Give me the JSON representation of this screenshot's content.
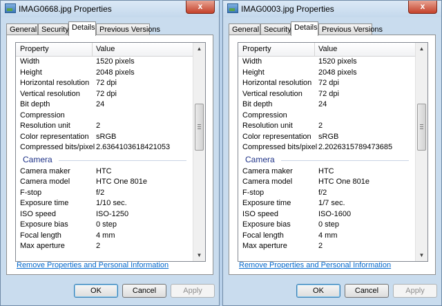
{
  "windows": [
    {
      "title": "IMAG0668.jpg Properties",
      "tabs": [
        {
          "label": "General",
          "active": false
        },
        {
          "label": "Security",
          "active": false
        },
        {
          "label": "Details",
          "active": true
        },
        {
          "label": "Previous Versions",
          "active": false
        }
      ],
      "columns": {
        "property": "Property",
        "value": "Value"
      },
      "rows": [
        {
          "p": "Width",
          "v": "1520 pixels"
        },
        {
          "p": "Height",
          "v": "2048 pixels"
        },
        {
          "p": "Horizontal resolution",
          "v": "72 dpi"
        },
        {
          "p": "Vertical resolution",
          "v": "72 dpi"
        },
        {
          "p": "Bit depth",
          "v": "24"
        },
        {
          "p": "Compression",
          "v": ""
        },
        {
          "p": "Resolution unit",
          "v": "2"
        },
        {
          "p": "Color representation",
          "v": "sRGB"
        },
        {
          "p": "Compressed bits/pixel",
          "v": "2.6364103618421053"
        },
        {
          "section": "Camera"
        },
        {
          "p": "Camera maker",
          "v": "HTC"
        },
        {
          "p": "Camera model",
          "v": "HTC One 801e"
        },
        {
          "p": "F-stop",
          "v": "f/2"
        },
        {
          "p": "Exposure time",
          "v": "1/10 sec."
        },
        {
          "p": "ISO speed",
          "v": "ISO-1250"
        },
        {
          "p": "Exposure bias",
          "v": "0 step"
        },
        {
          "p": "Focal length",
          "v": "4 mm"
        },
        {
          "p": "Max aperture",
          "v": "2"
        }
      ],
      "scroll_position": 0.33,
      "link": "Remove Properties and Personal Information",
      "buttons": {
        "ok": "OK",
        "cancel": "Cancel",
        "apply": "Apply"
      },
      "close": "x"
    },
    {
      "title": "IMAG0003.jpg Properties",
      "tabs": [
        {
          "label": "General",
          "active": false
        },
        {
          "label": "Security",
          "active": false
        },
        {
          "label": "Details",
          "active": true
        },
        {
          "label": "Previous Versions",
          "active": false
        }
      ],
      "columns": {
        "property": "Property",
        "value": "Value"
      },
      "rows": [
        {
          "p": "Width",
          "v": "1520 pixels"
        },
        {
          "p": "Height",
          "v": "2048 pixels"
        },
        {
          "p": "Horizontal resolution",
          "v": "72 dpi"
        },
        {
          "p": "Vertical resolution",
          "v": "72 dpi"
        },
        {
          "p": "Bit depth",
          "v": "24"
        },
        {
          "p": "Compression",
          "v": ""
        },
        {
          "p": "Resolution unit",
          "v": "2"
        },
        {
          "p": "Color representation",
          "v": "sRGB"
        },
        {
          "p": "Compressed bits/pixel",
          "v": "2.2026315789473685"
        },
        {
          "section": "Camera"
        },
        {
          "p": "Camera maker",
          "v": "HTC"
        },
        {
          "p": "Camera model",
          "v": "HTC One 801e"
        },
        {
          "p": "F-stop",
          "v": "f/2"
        },
        {
          "p": "Exposure time",
          "v": "1/7 sec."
        },
        {
          "p": "ISO speed",
          "v": "ISO-1600"
        },
        {
          "p": "Exposure bias",
          "v": "0 step"
        },
        {
          "p": "Focal length",
          "v": "4 mm"
        },
        {
          "p": "Max aperture",
          "v": "2"
        }
      ],
      "scroll_position": 0.33,
      "link": "Remove Properties and Personal Information",
      "buttons": {
        "ok": "OK",
        "cancel": "Cancel",
        "apply": "Apply"
      },
      "close": "x"
    }
  ]
}
